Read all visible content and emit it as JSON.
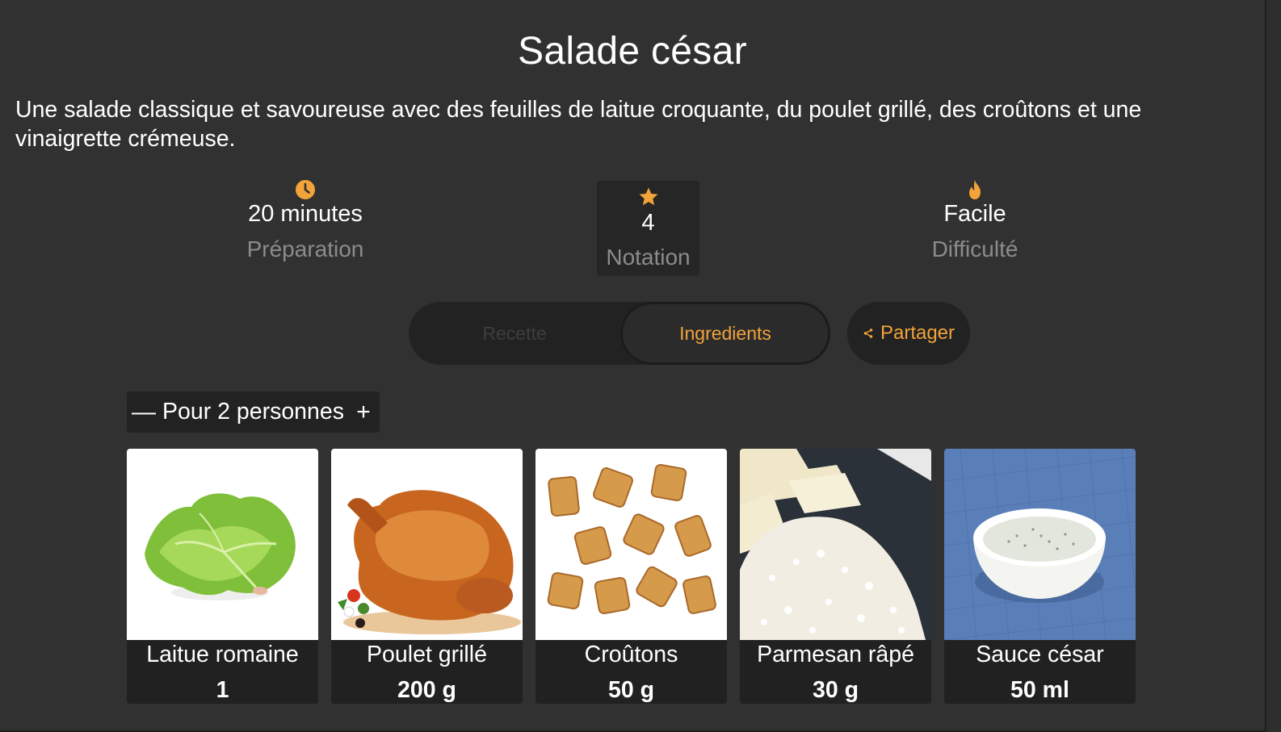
{
  "recipe": {
    "title": "Salade césar",
    "description": "Une salade classique et savoureuse avec des feuilles de laitue croquante, du poulet grillé, des croûtons et une vinaigrette crémeuse."
  },
  "stats": {
    "prep": {
      "value": "20 minutes",
      "label": "Préparation",
      "icon": "clock-icon"
    },
    "rating": {
      "value": "4",
      "label": "Notation",
      "icon": "star-icon"
    },
    "difficulty": {
      "value": "Facile",
      "label": "Difficulté",
      "icon": "flame-icon"
    }
  },
  "tabs": {
    "recette": "Recette",
    "ingredients": "Ingredients",
    "active": "ingredients"
  },
  "share": {
    "label": "Partager",
    "icon": "share-icon"
  },
  "servings": {
    "label": "Pour 2 personnes",
    "minus": "—",
    "plus": "+"
  },
  "ingredients": [
    {
      "name": "Laitue romaine",
      "qty": "1"
    },
    {
      "name": "Poulet grillé",
      "qty": "200 g"
    },
    {
      "name": "Croûtons",
      "qty": "50 g"
    },
    {
      "name": "Parmesan râpé",
      "qty": "30 g"
    },
    {
      "name": "Sauce césar",
      "qty": "50 ml"
    }
  ],
  "colors": {
    "accent": "#f2a33a",
    "background": "#313131",
    "panel": "#222222",
    "muted": "#8c8c8c"
  }
}
